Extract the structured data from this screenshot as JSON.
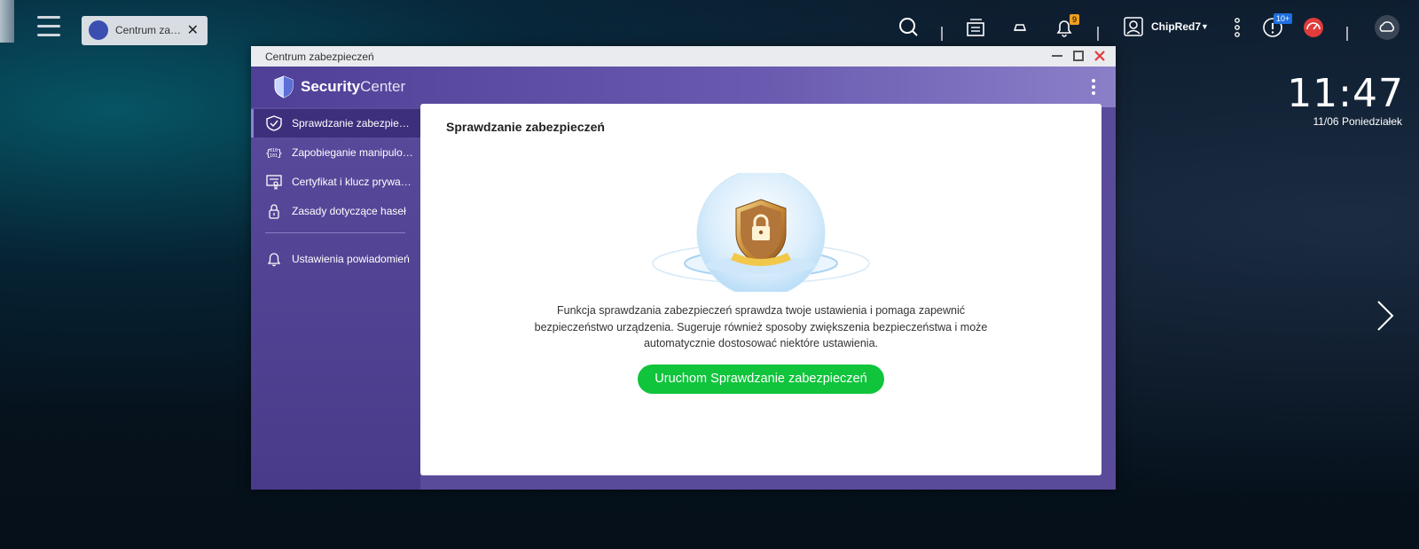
{
  "taskbar": {
    "app_tab_label": "Centrum zabezpieczeń",
    "notification_badge": "9",
    "user_name": "ChipRed7",
    "updates_badge": "10+"
  },
  "desktop": {
    "time": "11:47",
    "date": "11/06 Poniedziałek"
  },
  "window": {
    "title": "Centrum zabezpieczeń",
    "brand_bold": "Security",
    "brand_light": "Center"
  },
  "sidebar": {
    "items": [
      {
        "label": "Sprawdzanie zabezpieczeń",
        "icon": "shield-check-icon",
        "active": true
      },
      {
        "label": "Zapobieganie manipulowaniu",
        "icon": "binary-code-icon",
        "active": false
      },
      {
        "label": "Certyfikat i klucz prywatny",
        "icon": "certificate-icon",
        "active": false
      },
      {
        "label": "Zasady dotyczące haseł",
        "icon": "lock-icon",
        "active": false
      },
      {
        "label": "Ustawienia powiadomień",
        "icon": "bell-icon",
        "active": false
      }
    ]
  },
  "main": {
    "title": "Sprawdzanie zabezpieczeń",
    "description": "Funkcja sprawdzania zabezpieczeń sprawdza twoje ustawienia i pomaga zapewnić bezpieczeństwo urządzenia. Sugeruje również sposoby zwiększenia bezpieczeństwa i może automatycznie dostosować niektóre ustawienia.",
    "run_button": "Uruchom Sprawdzanie zabezpieczeń"
  },
  "colors": {
    "accent_purple": "#5a4a9a",
    "button_green": "#10c43c",
    "close_red": "#e03c3c"
  }
}
